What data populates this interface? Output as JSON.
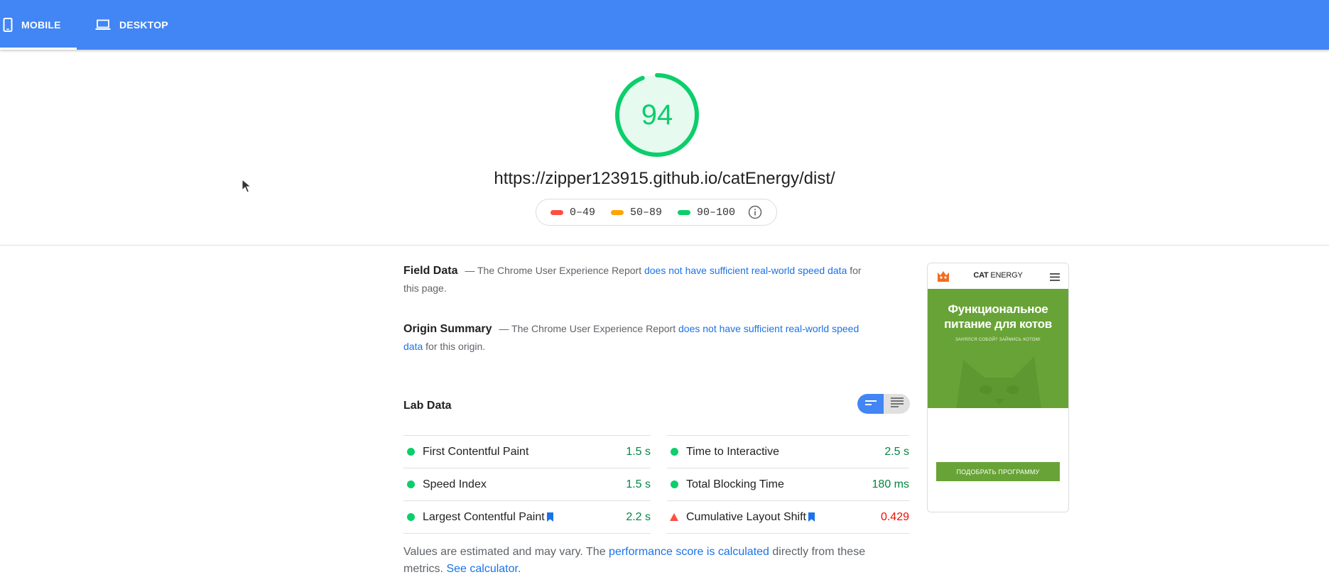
{
  "tabs": [
    {
      "label": "MOBILE",
      "icon": "smartphone-icon",
      "active": true
    },
    {
      "label": "DESKTOP",
      "icon": "laptop-icon",
      "active": false
    }
  ],
  "score": {
    "value": "94",
    "fraction": 0.94,
    "color": "#0cce6b"
  },
  "url": "https://zipper123915.github.io/catEnergy/dist/",
  "legend": [
    {
      "range": "0–49",
      "color": "#ff4e42"
    },
    {
      "range": "50–89",
      "color": "#ffa400"
    },
    {
      "range": "90–100",
      "color": "#0cce6b"
    }
  ],
  "field_data": {
    "title": "Field Data",
    "prefix": "— The Chrome User Experience Report",
    "link": "does not have sufficient real-world speed data",
    "suffix": "for this page."
  },
  "origin_summary": {
    "title": "Origin Summary",
    "prefix": "— The Chrome User Experience Report",
    "link": "does not have sufficient real-world speed data",
    "suffix": "for this origin."
  },
  "lab": {
    "title": "Lab Data",
    "metrics_left": [
      {
        "name": "First Contentful Paint",
        "value": "1.5 s",
        "status": "good",
        "bookmark": false
      },
      {
        "name": "Speed Index",
        "value": "1.5 s",
        "status": "good",
        "bookmark": false
      },
      {
        "name": "Largest Contentful Paint",
        "value": "2.2 s",
        "status": "good",
        "bookmark": true
      }
    ],
    "metrics_right": [
      {
        "name": "Time to Interactive",
        "value": "2.5 s",
        "status": "good",
        "bookmark": false
      },
      {
        "name": "Total Blocking Time",
        "value": "180 ms",
        "status": "good",
        "bookmark": false
      },
      {
        "name": "Cumulative Layout Shift",
        "value": "0.429",
        "status": "poor",
        "bookmark": true
      }
    ]
  },
  "footnote": {
    "text1": "Values are estimated and may vary. The",
    "link1": "performance score is calculated",
    "text2": "directly from these metrics.",
    "link2": "See calculator."
  },
  "preview": {
    "brand_bold": "CAT",
    "brand_light": "ENERGY",
    "hero_title_line1": "Функциональное",
    "hero_title_line2": "питание для котов",
    "hero_subtitle": "ЗАНЯЛСЯ СОБОЙ? ЗАЙМИСЬ КОТОМ!",
    "button": "ПОДОБРАТЬ ПРОГРАММУ"
  },
  "colors": {
    "header": "#4285f4",
    "link": "#1a73e8",
    "good": "#018642",
    "poor": "#eb0f00"
  }
}
